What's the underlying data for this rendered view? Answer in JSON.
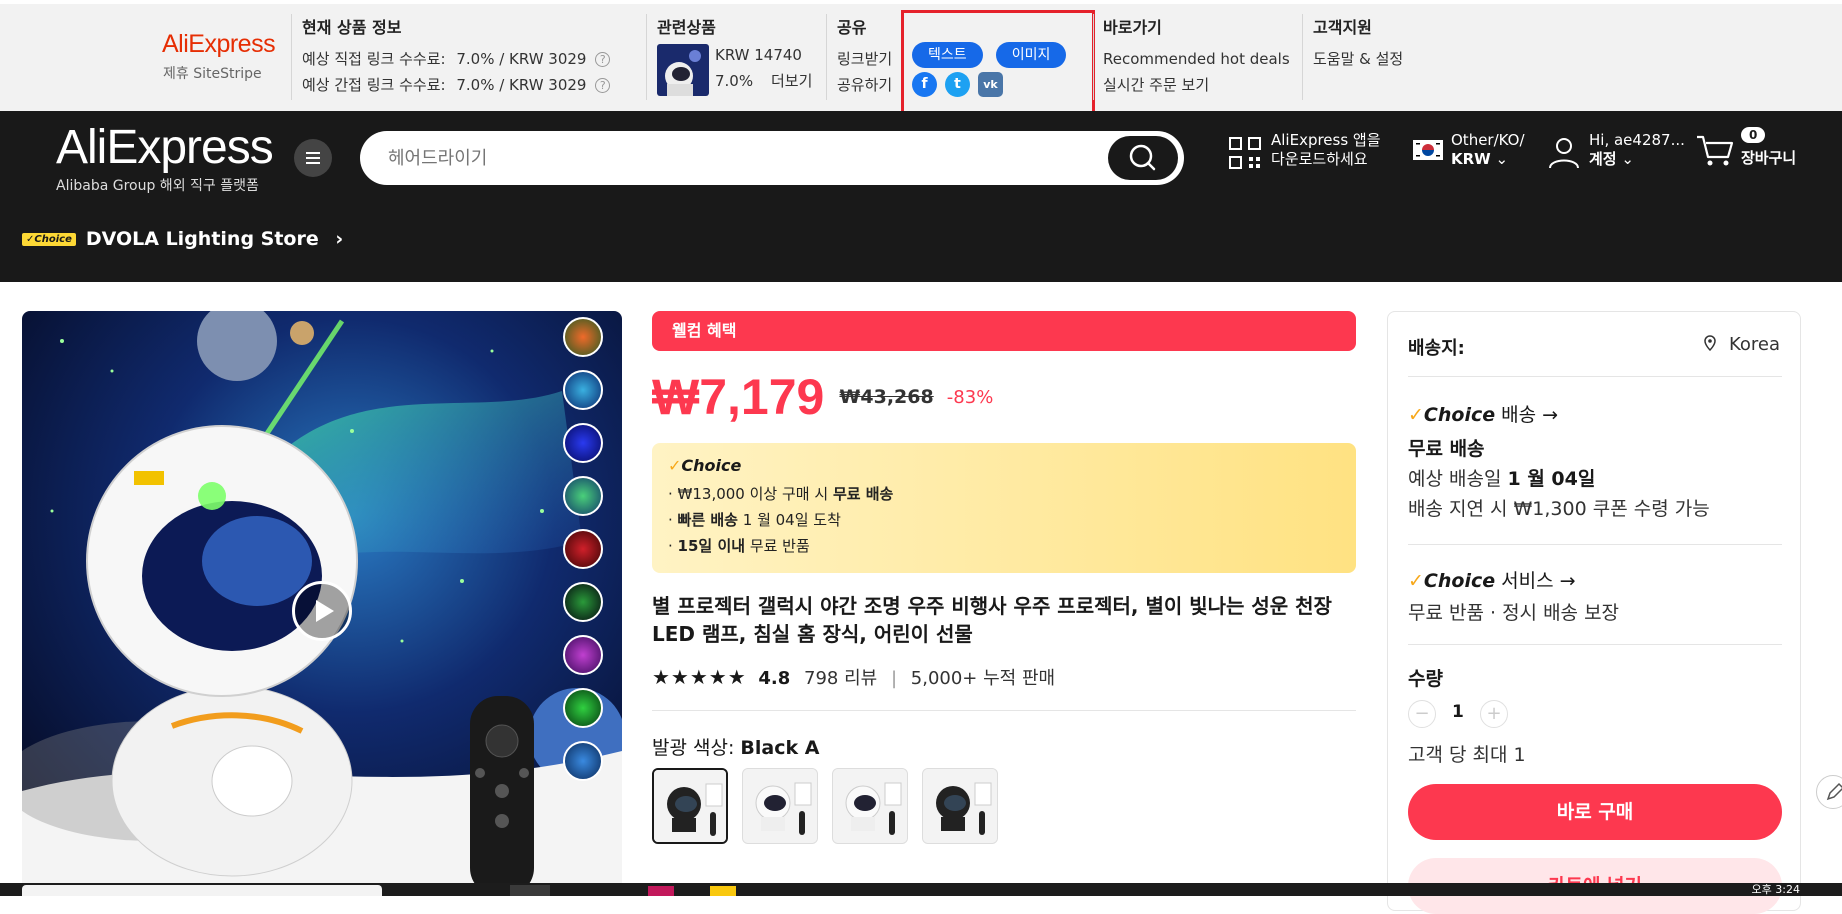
{
  "sitestripe": {
    "brand": "AliExpress",
    "sub": "제휴 SiteStripe",
    "current": {
      "title": "현재 상품 정보",
      "direct_label": "예상 직접 링크 수수료:",
      "direct_value": "7.0% / KRW 3029",
      "indirect_label": "예상 간접 링크 수수료:",
      "indirect_value": "7.0% / KRW 3029",
      "help": "?"
    },
    "related": {
      "title": "관련상품",
      "price": "KRW 14740",
      "rate": "7.0%",
      "more": "더보기"
    },
    "share": {
      "title": "공유",
      "get_link": "링크받기",
      "share_label": "공유하기",
      "text_btn": "텍스트",
      "image_btn": "이미지",
      "facebook": "f",
      "twitter": "t",
      "vk": "vk"
    },
    "shortcuts": {
      "title": "바로가기",
      "hot_deals": "Recommended hot deals",
      "live_orders": "실시간 주문 보기"
    },
    "support": {
      "title": "고객지원",
      "help_settings": "도움말 & 설정"
    }
  },
  "header": {
    "logo": "AliExpress",
    "tagline": "Alibaba Group 해외 직구 플랫폼",
    "search_placeholder": "헤어드라이기",
    "app_line1": "AliExpress 앱을",
    "app_line2": "다운로드하세요",
    "region_line1": "Other/KO/",
    "region_line2": "KRW",
    "account_line1": "Hi, ae4287...",
    "account_line2": "계정",
    "cart_count": "0",
    "cart_label": "장바구니",
    "store_badge": "Choice",
    "store_name": "DVOLA Lighting Store"
  },
  "product": {
    "welcome": "웰컴 혜택",
    "price": "₩7,179",
    "old_price": "₩43,268",
    "discount": "-83%",
    "choice_title": "Choice",
    "choice_line1_a": "· ₩13,000 이상 구매 시 ",
    "choice_line1_b": "무료 배송",
    "choice_line2_a": "· ",
    "choice_line2_b": "빠른 배송",
    "choice_line2_c": " 1 월 04일 도착",
    "choice_line3_a": "· ",
    "choice_line3_b": "15일 이내",
    "choice_line3_c": " 무료 반품",
    "title": "별 프로젝터 갤럭시 야간 조명 우주 비행사 우주 프로젝터, 별이 빛나는 성운 천장 LED 램프, 침실 홈 장식, 어린이 선물",
    "stars": "★★★★★",
    "rating": "4.8",
    "reviews": "798 리뷰",
    "sold": "5,000+ 누적 판매",
    "color_label": "발광 색상: ",
    "color_value": "Black A"
  },
  "panel": {
    "ship_to": "배송지:",
    "location": "Korea",
    "choice_shipping": "Choice",
    "choice_shipping_suffix": " 배송 →",
    "free_shipping": "무료 배송",
    "eta_prefix": "예상 배송일 ",
    "eta_date": "1 월 04일",
    "delay_coupon": "배송 지연 시 ₩1,300 쿠폰 수령 가능",
    "choice_service": "Choice",
    "choice_service_suffix": " 서비스 →",
    "service_desc": "무료 반품 · 정시 배송 보장",
    "qty_label": "수량",
    "qty_value": "1",
    "qty_max": "고객 당 최대 1",
    "buy_now": "바로 구매",
    "add_cart": "카트에 넣기"
  },
  "taskbar": {
    "clock": "오후 3:24"
  },
  "colors": {
    "accent_red": "#fd384f",
    "link_blue": "#1a73d6",
    "pill_blue": "#1669e8",
    "choice_yellow": "#fdd835",
    "header_bg": "#191919"
  }
}
